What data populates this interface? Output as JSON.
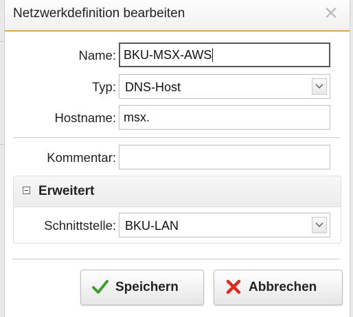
{
  "dialog": {
    "title": "Netzwerkdefinition bearbeiten",
    "close_glyph": "✕"
  },
  "form": {
    "name_label": "Name:",
    "name_value": "BKU-MSX-AWS",
    "type_label": "Typ:",
    "type_value": "DNS-Host",
    "hostname_label": "Hostname:",
    "hostname_value": "msx.",
    "comment_label": "Kommentar:",
    "comment_value": ""
  },
  "advanced": {
    "title": "Erweitert",
    "interface_label": "Schnittstelle:",
    "interface_value": "BKU-LAN"
  },
  "buttons": {
    "save_label": "Speichern",
    "cancel_label": "Abbrechen"
  },
  "colors": {
    "accent": "#f0a030",
    "save_icon": "#3aa02a",
    "cancel_icon": "#d92b1e"
  },
  "icons": {
    "close": "close-icon",
    "collapse": "minus-square-icon",
    "dropdown": "chevron-down-icon",
    "save": "checkmark-icon",
    "cancel": "x-icon"
  }
}
